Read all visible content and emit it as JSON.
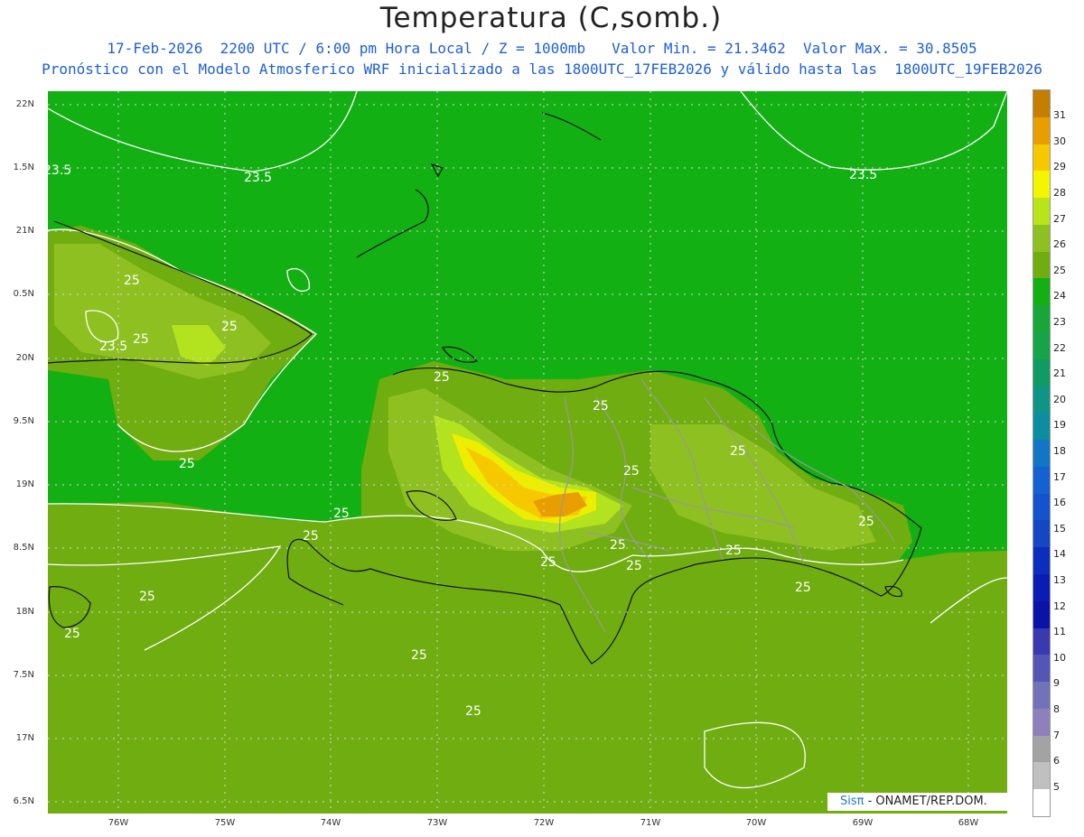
{
  "title": "Temperatura (C,somb.)",
  "subtitle_line1": "17-Feb-2026  2200 UTC / 6:00 pm Hora Local / Z = 1000mb   Valor Min. = 21.3462  Valor Max. = 30.8505",
  "subtitle_line2": "Pronóstico con el Modelo Atmosferico WRF inicializado a las 1800UTC_17FEB2026 y válido hasta las  1800UTC_19FEB2026",
  "map": {
    "lon_range": [
      -76.67,
      -67.67
    ],
    "lat_range": [
      16.42,
      22.08
    ],
    "lat_ticks": [
      "22N",
      "1.5N",
      "21N",
      "0.5N",
      "20N",
      "9.5N",
      "19N",
      "8.5N",
      "18N",
      "7.5N",
      "17N",
      "6.5N"
    ],
    "lon_ticks": [
      "76W",
      "75W",
      "74W",
      "73W",
      "72W",
      "71W",
      "70W",
      "69W",
      "68W"
    ],
    "contour_labels": [
      "23.5",
      "23.5",
      "23.5",
      "23.5",
      "25",
      "25",
      "25",
      "25",
      "25",
      "25",
      "25",
      "25",
      "25",
      "25",
      "25",
      "25",
      "25",
      "25",
      "25",
      "25",
      "25",
      "25",
      "25",
      "25"
    ],
    "colors": {
      "t24": "#13b013",
      "t25": "#70ad11",
      "t26": "#8fc021",
      "t27": "#b3e21e",
      "t28": "#eded00",
      "t29": "#f6c800",
      "t30": "#e89e00",
      "coast": "#111111",
      "border": "#999999",
      "contour": "#ffffff"
    }
  },
  "legend": {
    "labels": [
      "31",
      "30",
      "29",
      "28",
      "27",
      "26",
      "25",
      "24",
      "23",
      "22",
      "21",
      "20",
      "19",
      "18",
      "17",
      "16",
      "15",
      "14",
      "13",
      "12",
      "11",
      "10",
      "9",
      "8",
      "7",
      "6",
      "5"
    ],
    "colors": [
      "#c47f00",
      "#e89e00",
      "#f6c800",
      "#f5f500",
      "#b8e51a",
      "#8fc021",
      "#70ad11",
      "#13b013",
      "#18a637",
      "#17a34a",
      "#0f9b63",
      "#0f9485",
      "#0d8da0",
      "#1177c5",
      "#1462d2",
      "#1552cd",
      "#1546c4",
      "#0c2ebd",
      "#0b1cb5",
      "#0b12a8",
      "#3a3ab0",
      "#5555b5",
      "#7272b8",
      "#8f80bd",
      "#a3a3a3",
      "#c0c0c0",
      "#ffffff"
    ]
  },
  "credit": {
    "brand": "Sisπ",
    "text": " - ONAMET/REP.DOM."
  }
}
